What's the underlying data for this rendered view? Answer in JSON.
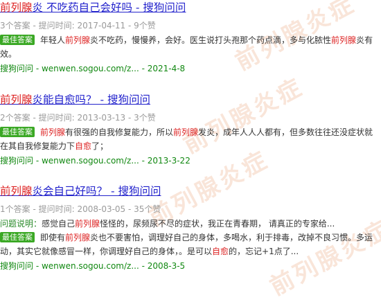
{
  "watermark": "前列腺炎症",
  "badge_label": "最佳答案",
  "question_label": "问题说明：",
  "results": [
    {
      "title_hl": "前列腺",
      "title_rest": "炎 不吃药自己会好吗 - 搜狗问问",
      "meta": "3个答案 - 提问时间: 2017-04-11 - 9个赞",
      "answer_parts": [
        "年轻人",
        "前列腺",
        "炎不吃药，慢慢养，会好。医生说打头孢那个药点滴，多与化脓性",
        "前列腺",
        "炎有效。"
      ],
      "source": "搜狗问问 - wenwen.sogou.com/z... - 2021-4-8"
    },
    {
      "title_hl": "前列腺",
      "title_rest": "炎能自愈吗？ - 搜狗问问",
      "meta": "2个答案 - 提问时间: 2013-03-13 - 3个赞",
      "answer_parts": [
        "前列腺",
        "有很强的自我修复能力，所以",
        "前列腺",
        "发炎，成年人人人都有，但多数往往还没症状就在其自我修复能力下",
        "自愈",
        "了；"
      ],
      "source": "搜狗问问 - wenwen.sogou.com/z... - 2013-3-22"
    },
    {
      "title_hl": "前列腺",
      "title_rest": "炎会自己好吗？ - 搜狗问问",
      "meta": "1个答案 - 提问时间: 2008-03-05 - 35个赞",
      "question_parts": [
        "感觉自己",
        "前列腺",
        "怪怪的，尿频尿不尽的症状，我正在青春期， 请真正的专家给..."
      ],
      "answer_parts": [
        "即使有",
        "前列腺",
        "炎也不要害怕，调理好自己的身体，多喝水，利于排毒，改掉不良习惯。多运动，其实它就像感冒一样，你调理好自己的身体，。是可以",
        "自愈",
        "的，忘记+1点了..."
      ],
      "source": "搜狗问问 - wenwen.sogou.com/z... - 2008-3-5"
    }
  ]
}
